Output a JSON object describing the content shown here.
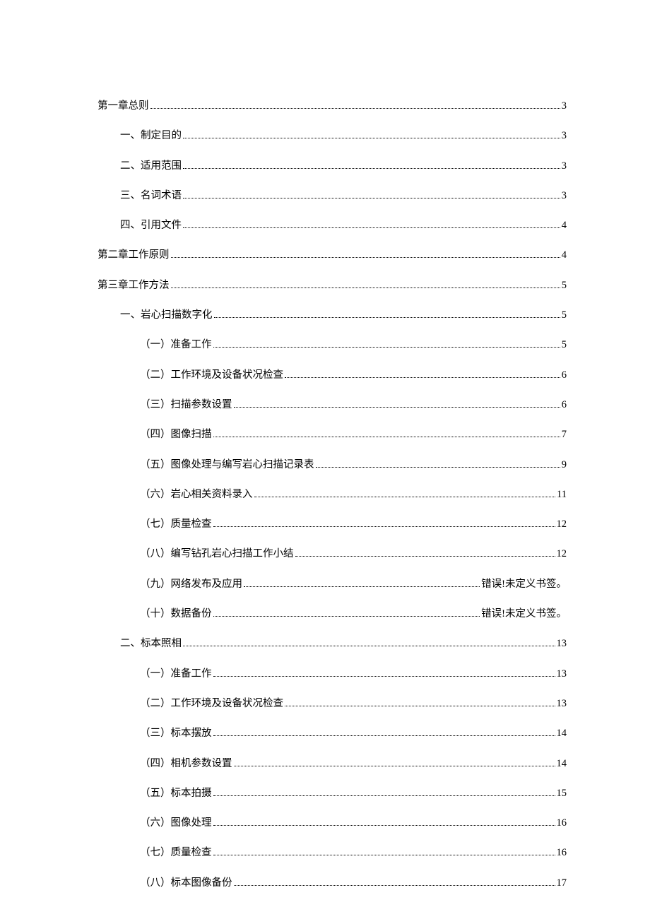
{
  "entries": [
    {
      "level": 0,
      "label": "第一章总则",
      "page": "3"
    },
    {
      "level": 1,
      "label": "一、制定目的",
      "page": "3"
    },
    {
      "level": 1,
      "label": "二、适用范围",
      "page": "3"
    },
    {
      "level": 1,
      "label": "三、名词术语",
      "page": "3"
    },
    {
      "level": 1,
      "label": "四、引用文件",
      "page": "4"
    },
    {
      "level": 0,
      "label": "第二章工作原则",
      "page": "4"
    },
    {
      "level": 0,
      "label": "第三章工作方法",
      "page": "5"
    },
    {
      "level": 1,
      "label": "一、岩心扫描数字化",
      "page": "5"
    },
    {
      "level": 2,
      "label": "（一）准备工作",
      "page": "5"
    },
    {
      "level": 2,
      "label": "（二）工作环境及设备状况检查",
      "page": "6"
    },
    {
      "level": 2,
      "label": "（三）扫描参数设置",
      "page": "6"
    },
    {
      "level": 2,
      "label": "（四）图像扫描",
      "page": "7"
    },
    {
      "level": 2,
      "label": "（五）图像处理与编写岩心扫描记录表",
      "page": "9"
    },
    {
      "level": 2,
      "label": "（六）岩心相关资料录入",
      "page": "11"
    },
    {
      "level": 2,
      "label": "（七）质量检查",
      "page": "12"
    },
    {
      "level": 2,
      "label": "（八）编写钻孔岩心扫描工作小结",
      "page": "12"
    },
    {
      "level": 2,
      "label": "（九）网络发布及应用",
      "page": "错误!未定义书签。"
    },
    {
      "level": 2,
      "label": "（十）数据备份",
      "page": "错误!未定义书签。"
    },
    {
      "level": 1,
      "label": "二、标本照相",
      "page": "13"
    },
    {
      "level": 2,
      "label": "（一）准备工作",
      "page": "13"
    },
    {
      "level": 2,
      "label": "（二）工作环境及设备状况检查",
      "page": "13"
    },
    {
      "level": 2,
      "label": "（三）标本摆放",
      "page": "14"
    },
    {
      "level": 2,
      "label": "（四）相机参数设置",
      "page": "14"
    },
    {
      "level": 2,
      "label": "（五）标本拍摄",
      "page": "15"
    },
    {
      "level": 2,
      "label": "（六）图像处理",
      "page": "16"
    },
    {
      "level": 2,
      "label": "（七）质量检查",
      "page": "16"
    },
    {
      "level": 2,
      "label": "（八）标本图像备份",
      "page": "17"
    }
  ]
}
